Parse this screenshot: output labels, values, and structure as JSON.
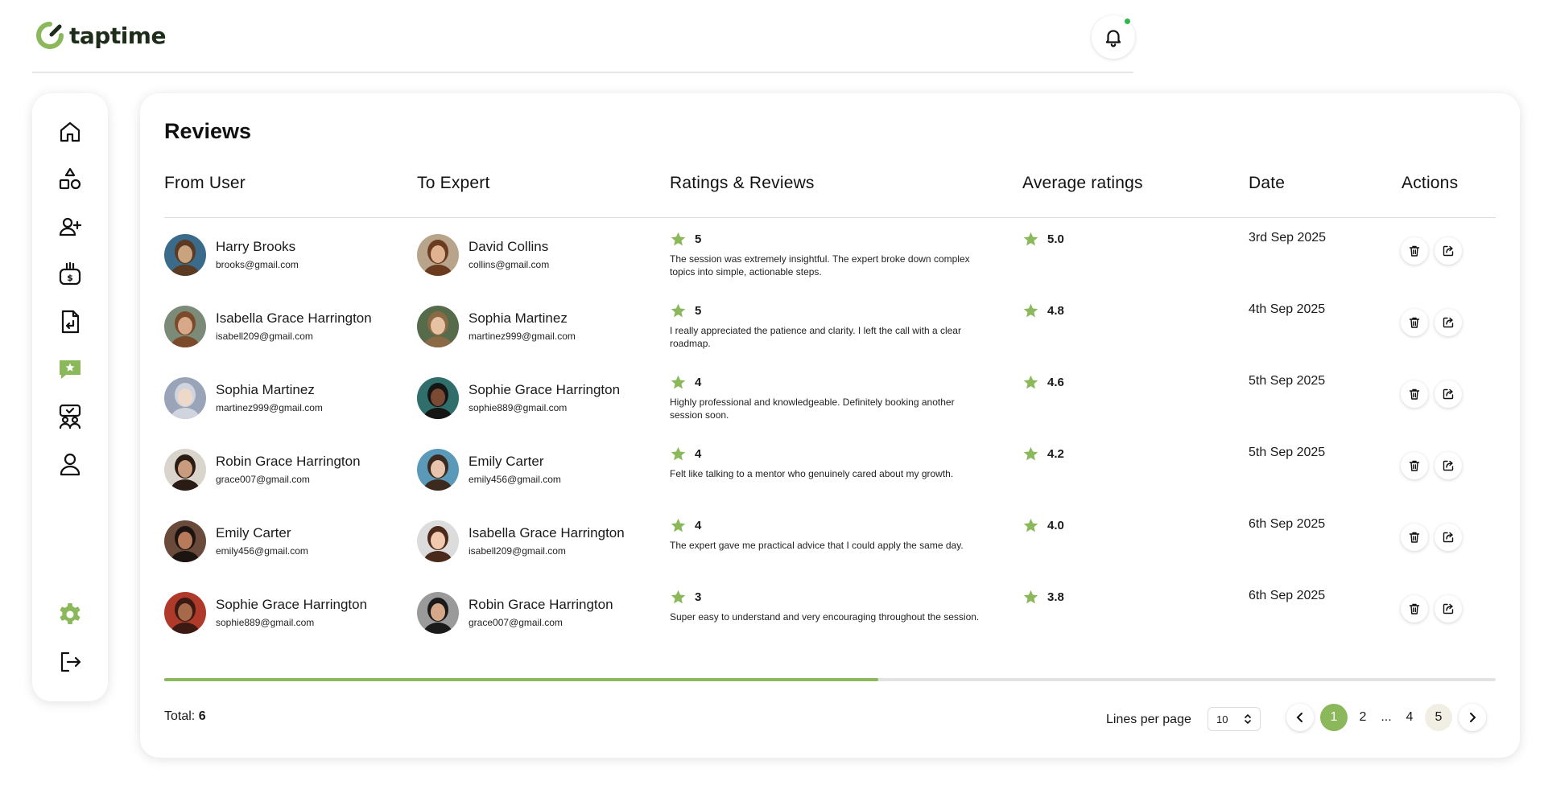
{
  "app": {
    "brand": "taptime"
  },
  "colors": {
    "accent": "#8ab85b",
    "notification_dot": "#2fb84a"
  },
  "sidebar": {
    "items": [
      {
        "name": "home",
        "icon": "home-icon"
      },
      {
        "name": "categories",
        "icon": "shapes-icon"
      },
      {
        "name": "add-user",
        "icon": "user-plus-icon"
      },
      {
        "name": "payments",
        "icon": "money-bag-icon"
      },
      {
        "name": "documents",
        "icon": "document-return-icon"
      },
      {
        "name": "reviews",
        "icon": "chat-star-icon",
        "active": true
      },
      {
        "name": "sessions",
        "icon": "board-people-icon"
      },
      {
        "name": "profile",
        "icon": "user-icon"
      }
    ],
    "bottom": [
      {
        "name": "settings",
        "icon": "gear-icon"
      },
      {
        "name": "logout",
        "icon": "logout-icon"
      }
    ]
  },
  "page": {
    "title": "Reviews",
    "columns": {
      "from_user": "From User",
      "to_expert": "To Expert",
      "ratings_reviews": "Ratings & Reviews",
      "average_ratings": "Average ratings",
      "date": "Date",
      "actions": "Actions"
    },
    "rows": [
      {
        "from": {
          "name": "Harry Brooks",
          "email": "brooks@gmail.com"
        },
        "to": {
          "name": "David Collins",
          "email": "collins@gmail.com"
        },
        "rating": "5",
        "review": "The session was extremely insightful. The expert broke down complex topics into simple, actionable steps.",
        "avg": "5.0",
        "date": "3rd Sep 2025"
      },
      {
        "from": {
          "name": "Isabella Grace Harrington",
          "email": "isabell209@gmail.com"
        },
        "to": {
          "name": "Sophia Martinez",
          "email": "martinez999@gmail.com"
        },
        "rating": "5",
        "review": "I really appreciated the patience and clarity. I left the call with a clear roadmap.",
        "avg": "4.8",
        "date": "4th Sep 2025"
      },
      {
        "from": {
          "name": "Sophia Martinez",
          "email": "martinez999@gmail.com"
        },
        "to": {
          "name": "Sophie Grace Harrington",
          "email": "sophie889@gmail.com"
        },
        "rating": "4",
        "review": "Highly professional and knowledgeable. Definitely booking another session soon.",
        "avg": "4.6",
        "date": "5th Sep 2025"
      },
      {
        "from": {
          "name": "Robin Grace Harrington",
          "email": "grace007@gmail.com"
        },
        "to": {
          "name": "Emily Carter",
          "email": "emily456@gmail.com"
        },
        "rating": "4",
        "review": "Felt like talking to a mentor who genuinely cared about my growth.",
        "avg": "4.2",
        "date": "5th Sep 2025"
      },
      {
        "from": {
          "name": "Emily Carter",
          "email": "emily456@gmail.com"
        },
        "to": {
          "name": "Isabella Grace Harrington",
          "email": "isabell209@gmail.com"
        },
        "rating": "4",
        "review": "The expert gave me practical advice that I could apply the same day.",
        "avg": "4.0",
        "date": "6th Sep 2025"
      },
      {
        "from": {
          "name": "Sophie Grace Harrington",
          "email": "sophie889@gmail.com"
        },
        "to": {
          "name": "Robin Grace Harrington",
          "email": "grace007@gmail.com"
        },
        "rating": "3",
        "review": "Super easy to understand and very encouraging throughout the session.",
        "avg": "3.8",
        "date": "6th Sep 2025"
      }
    ],
    "horizontal_scroll_fraction": 0.536,
    "footer": {
      "total_label": "Total:",
      "total_value": "6",
      "lines_per_page_label": "Lines per page",
      "lines_per_page_value": "10",
      "pages": [
        "1",
        "2",
        "...",
        "4",
        "5"
      ],
      "current_page": "1"
    }
  }
}
